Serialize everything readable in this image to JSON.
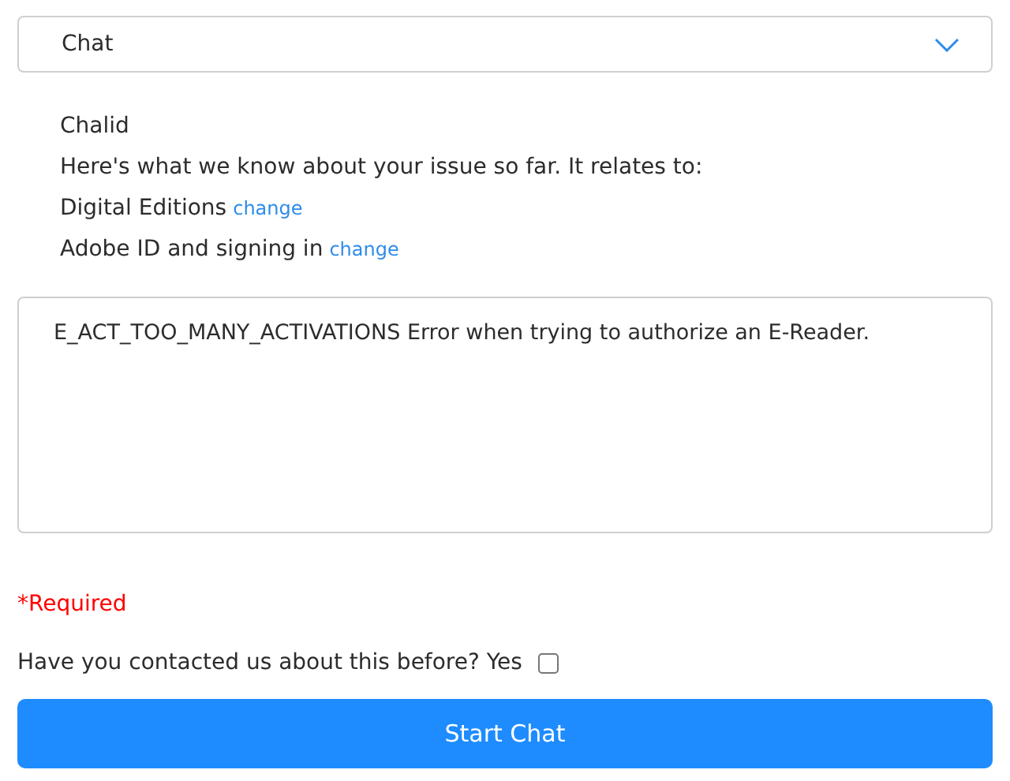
{
  "dropdown": {
    "value": "Chat"
  },
  "summary": {
    "name": "Chalid",
    "intro": "Here's what we know about your issue so far. It relates to:",
    "topics": [
      {
        "label": "Digital Editions",
        "link": "change"
      },
      {
        "label": "Adobe ID and signing in",
        "link": "change"
      }
    ]
  },
  "description": {
    "value": "E_ACT_TOO_MANY_ACTIVATIONS Error when trying to authorize an E-Reader."
  },
  "required_note": "*Required",
  "contacted_before": {
    "label": "Have you contacted us about this before? Yes",
    "checked": false
  },
  "submit_button": "Start Chat"
}
